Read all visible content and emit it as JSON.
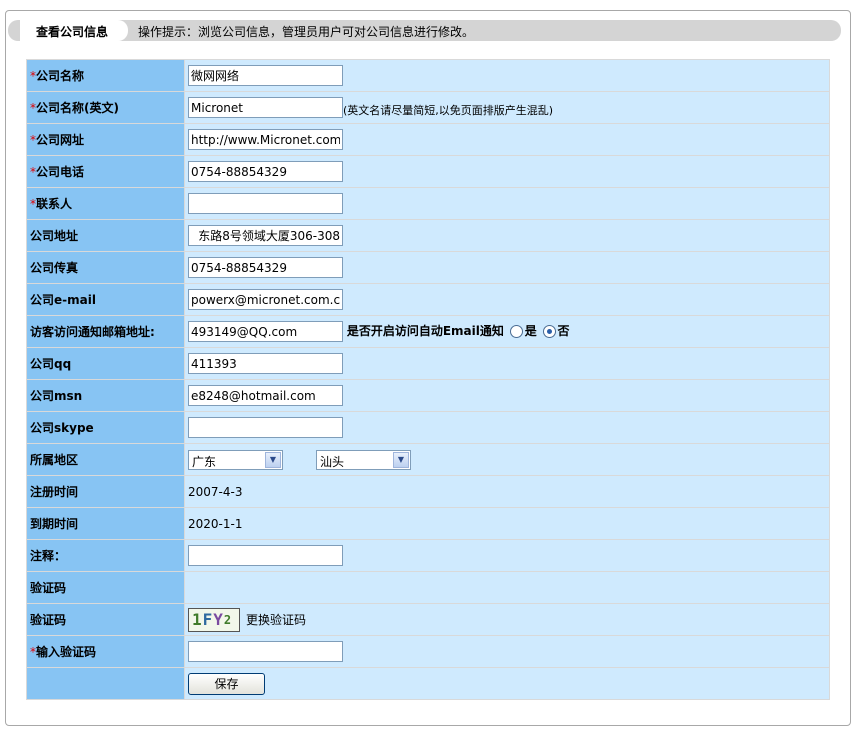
{
  "header": {
    "title": "查看公司信息",
    "tip": "操作提示：浏览公司信息，管理员用户可对公司信息进行修改。"
  },
  "required_mark": "*",
  "fields": {
    "company_name": {
      "label": "公司名称",
      "value": "微网网络"
    },
    "company_name_en": {
      "label": "公司名称(英文)",
      "value": "Micronet",
      "hint": "(英文名请尽量简短,以免页面排版产生混乱)"
    },
    "website": {
      "label": "公司网址",
      "value": "http://www.Micronet.com.c"
    },
    "phone": {
      "label": "公司电话",
      "value": "0754-88854329"
    },
    "contact": {
      "label": "联系人",
      "value": ""
    },
    "address": {
      "label": "公司地址",
      "value": "东路8号领域大厦306-308"
    },
    "fax": {
      "label": "公司传真",
      "value": "0754-88854329"
    },
    "email": {
      "label": "公司e-mail",
      "value": "powerx@micronet.com.cn"
    },
    "visitor_email": {
      "label": "访客访问通知邮箱地址:",
      "value": "493149@QQ.com",
      "auto_notify_question": "是否开启访问自动Email通知",
      "option_yes": "是",
      "option_no": "否",
      "selected": "否"
    },
    "qq": {
      "label": "公司qq",
      "value": "411393"
    },
    "msn": {
      "label": "公司msn",
      "value": "e8248@hotmail.com"
    },
    "skype": {
      "label": "公司skype",
      "value": ""
    },
    "region": {
      "label": "所属地区",
      "province": "广东",
      "city": "汕头"
    },
    "register_time": {
      "label": "注册时间",
      "value": "2007-4-3"
    },
    "expire_time": {
      "label": "到期时间",
      "value": "2020-1-1"
    },
    "remark": {
      "label": "注释：",
      "value": ""
    },
    "captcha_header": {
      "label": "验证码"
    },
    "captcha": {
      "label": "验证码",
      "image_text": "1FY2",
      "refresh_link": "更换验证码"
    },
    "captcha_input": {
      "label": "输入验证码",
      "value": ""
    }
  },
  "save_button": "保存",
  "colors": {
    "label_bg": "#87c4f3",
    "value_bg": "#cfeafe",
    "header_bar": "#d4d4d4",
    "required": "#e00000"
  }
}
